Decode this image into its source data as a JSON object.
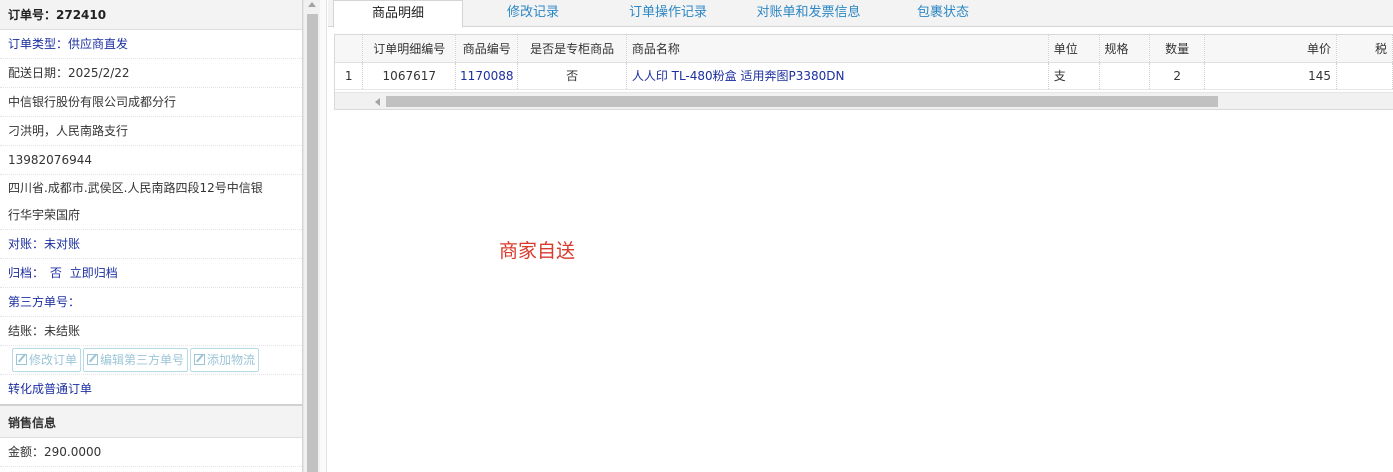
{
  "order": {
    "header_label": "订单号：272410",
    "type_label": "订单类型：供应商直发",
    "delivery_date": "配送日期：2025/2/22",
    "company": "中信银行股份有限公司成都分行",
    "contact": "刁洪明，人民南路支行",
    "phone": "13982076944",
    "address_line1": "四川省.成都市.武侯区.人民南路四段12号中信银",
    "address_line2": "行华宇荣国府",
    "reconcile": "对账：未对账",
    "archive_label": "归档：",
    "archive_value": "否",
    "archive_action": "立即归档",
    "third_party": "第三方单号：",
    "settle": "结账：未结账",
    "buttons": [
      "修改订单",
      "编辑第三方单号",
      "添加物流"
    ],
    "convert_link": "转化成普通订单"
  },
  "sales": {
    "header": "销售信息",
    "amount": "金额：290.0000"
  },
  "tabs": [
    "商品明细",
    "修改记录",
    "订单操作记录",
    "对账单和发票信息",
    "包裹状态"
  ],
  "active_tab": 0,
  "table": {
    "columns": [
      "",
      "订单明细编号",
      "商品编号",
      "是否是专柜商品",
      "商品名称",
      "单位",
      "规格",
      "数量",
      "单价",
      "税"
    ],
    "rows": [
      [
        "1",
        "1067617",
        "1170088",
        "否",
        "人人印 TL-480粉盒 适用奔图P3380DN",
        "支",
        "",
        "2",
        "145",
        ""
      ]
    ]
  },
  "notice": "商家自送",
  "colors": {
    "link": "#1c2fa0",
    "tab_link": "#2c87c4",
    "notice": "#d83a2b"
  }
}
